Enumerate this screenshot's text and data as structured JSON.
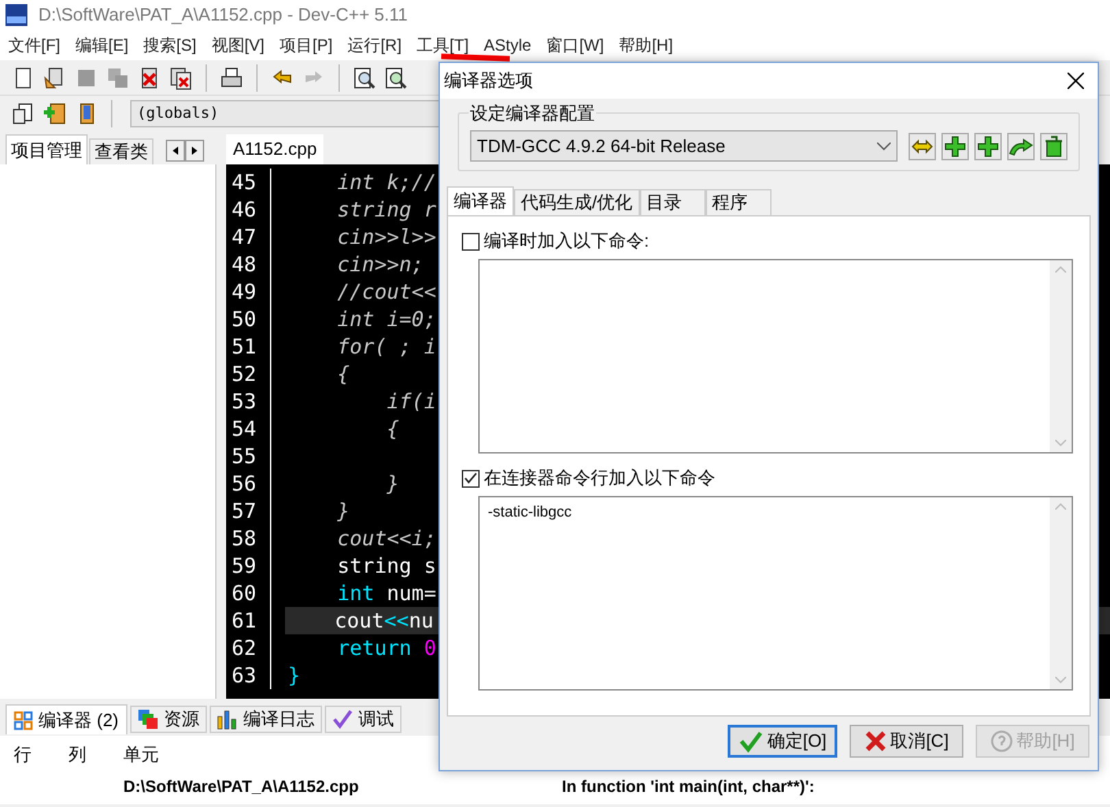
{
  "window": {
    "title": "D:\\SoftWare\\PAT_A\\A1152.cpp - Dev-C++ 5.11"
  },
  "menu": [
    "文件[F]",
    "编辑[E]",
    "搜索[S]",
    "视图[V]",
    "项目[P]",
    "运行[R]",
    "工具[T]",
    "AStyle",
    "窗口[W]",
    "帮助[H]"
  ],
  "scope_box": {
    "value": "(globals)"
  },
  "left_tabs": [
    {
      "label": "项目管理",
      "selected": true
    },
    {
      "label": "查看类",
      "selected": false
    }
  ],
  "editor_tabs": [
    {
      "label": "A1152.cpp",
      "selected": true
    }
  ],
  "code_lines": [
    {
      "number": "45",
      "selected": false,
      "segments": [
        {
          "kind": "italic",
          "text": "    int k;//"
        }
      ]
    },
    {
      "number": "46",
      "selected": false,
      "segments": [
        {
          "kind": "italic",
          "text": "    string r"
        }
      ]
    },
    {
      "number": "47",
      "selected": false,
      "segments": [
        {
          "kind": "italic",
          "text": "    cin>>l>>"
        }
      ]
    },
    {
      "number": "48",
      "selected": false,
      "segments": [
        {
          "kind": "italic",
          "text": "    cin>>n;"
        }
      ]
    },
    {
      "number": "49",
      "selected": false,
      "segments": [
        {
          "kind": "italic",
          "text": "    //cout<<"
        }
      ]
    },
    {
      "number": "50",
      "selected": false,
      "segments": [
        {
          "kind": "italic",
          "text": "    int i=0;"
        }
      ]
    },
    {
      "number": "51",
      "selected": false,
      "segments": [
        {
          "kind": "italic",
          "text": "    for( ; i"
        }
      ]
    },
    {
      "number": "52",
      "selected": false,
      "segments": [
        {
          "kind": "italic",
          "text": "    {"
        }
      ]
    },
    {
      "number": "53",
      "selected": false,
      "segments": [
        {
          "kind": "italic",
          "text": "        if(i"
        }
      ]
    },
    {
      "number": "54",
      "selected": false,
      "segments": [
        {
          "kind": "italic",
          "text": "        {"
        }
      ]
    },
    {
      "number": "55",
      "selected": false
    },
    {
      "number": "56",
      "selected": false,
      "segments": [
        {
          "kind": "italic",
          "text": "        }"
        }
      ]
    },
    {
      "number": "57",
      "selected": false,
      "segments": [
        {
          "kind": "italic",
          "text": "    }"
        }
      ]
    },
    {
      "number": "58",
      "selected": false,
      "segments": [
        {
          "kind": "italic",
          "text": "    cout<<i;"
        }
      ]
    },
    {
      "number": "59",
      "selected": false,
      "segments": [
        {
          "kind": "plain",
          "text": "    string s"
        }
      ]
    },
    {
      "number": "60",
      "selected": false,
      "segments": [
        {
          "kind": "keyword",
          "text": "    int"
        },
        {
          "kind": "plain",
          "text": " num="
        }
      ]
    },
    {
      "number": "61",
      "selected": true,
      "segments": [
        {
          "kind": "plain",
          "text": "    cout"
        },
        {
          "kind": "keyword",
          "text": "<<"
        },
        {
          "kind": "plain",
          "text": "nu"
        }
      ]
    },
    {
      "number": "62",
      "selected": false,
      "segments": [
        {
          "kind": "keyword",
          "text": "    return "
        },
        {
          "kind": "number",
          "text": "0"
        }
      ]
    },
    {
      "number": "63",
      "selected": false,
      "segments": [
        {
          "kind": "keyword",
          "text": "}"
        }
      ]
    }
  ],
  "bottom_tabs": [
    {
      "label": "编译器 (2)",
      "kind": "compiler",
      "selected": true
    },
    {
      "label": "资源",
      "kind": "resources",
      "selected": false
    },
    {
      "label": "编译日志",
      "kind": "log",
      "selected": false
    },
    {
      "label": "调试",
      "kind": "debug",
      "selected": false
    }
  ],
  "messages": {
    "columns": [
      "行",
      "列",
      "单元"
    ],
    "rows": [
      {
        "unit": "D:\\SoftWare\\PAT_A\\A1152.cpp",
        "message": "In function 'int main(int, char**)':"
      }
    ]
  },
  "dialog": {
    "title": "编译器选项",
    "group_label": "设定编译器配置",
    "compiler_select": {
      "value": "TDM-GCC 4.9.2 64-bit Release"
    },
    "tabs": [
      {
        "label": "编译器",
        "selected": true
      },
      {
        "label": "代码生成/优化",
        "selected": false
      },
      {
        "label": "目录",
        "selected": false
      },
      {
        "label": "程序",
        "selected": false
      }
    ],
    "options": [
      {
        "label": "编译时加入以下命令:",
        "checked": false
      },
      {
        "label": "在连接器命令行加入以下命令",
        "checked": true,
        "value": "-static-libgcc"
      }
    ],
    "buttons": [
      {
        "label": "确定[O]",
        "kind": "ok",
        "disabled": false
      },
      {
        "label": "取消[C]",
        "kind": "cancel",
        "disabled": false
      },
      {
        "label": "帮助[H]",
        "kind": "help",
        "disabled": true
      }
    ]
  }
}
